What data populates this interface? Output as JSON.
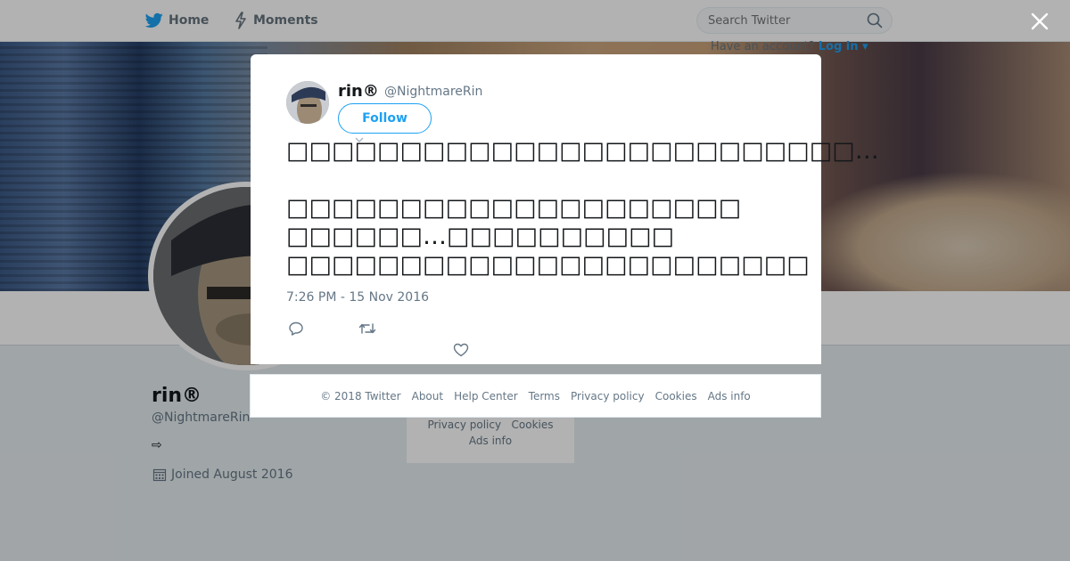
{
  "nav": {
    "home_label": "Home",
    "moments_label": "Moments"
  },
  "search": {
    "placeholder": "Search Twitter"
  },
  "account_prompt": {
    "text": "Have an account?",
    "login_label": "Log in"
  },
  "profile": {
    "name": "rin®",
    "handle": "@NightmareRin",
    "bio_glyph": "⇨",
    "joined": "Joined August 2016"
  },
  "background_footer": {
    "line1": "Privacy policy   Cookies",
    "line2": "Ads info"
  },
  "tweet": {
    "name": "rin®",
    "handle": "@NightmareRin",
    "follow_label": "Follow",
    "text": "□□□□□□□□□□□□□□□□□□□□□□□□□…\n\n□□□□□□□□□□□□□□□□□□□□\n□□□□□□…□□□□□□□□□□\n□□□□□□□□□□□□□□□□□□□□□□□",
    "timestamp": "7:26 PM - 15 Nov 2016"
  },
  "footer": {
    "copyright": "© 2018 Twitter",
    "links": [
      "About",
      "Help Center",
      "Terms",
      "Privacy policy",
      "Cookies",
      "Ads info"
    ]
  },
  "colors": {
    "accent": "#1da1f2",
    "muted": "#657786",
    "overlay": "rgba(0,0,0,0.3)"
  },
  "icons": [
    "twitter-bird-icon",
    "lightning-icon",
    "search-icon",
    "close-icon",
    "reply-icon",
    "retweet-icon",
    "heart-icon",
    "calendar-icon",
    "caret-down-icon"
  ]
}
